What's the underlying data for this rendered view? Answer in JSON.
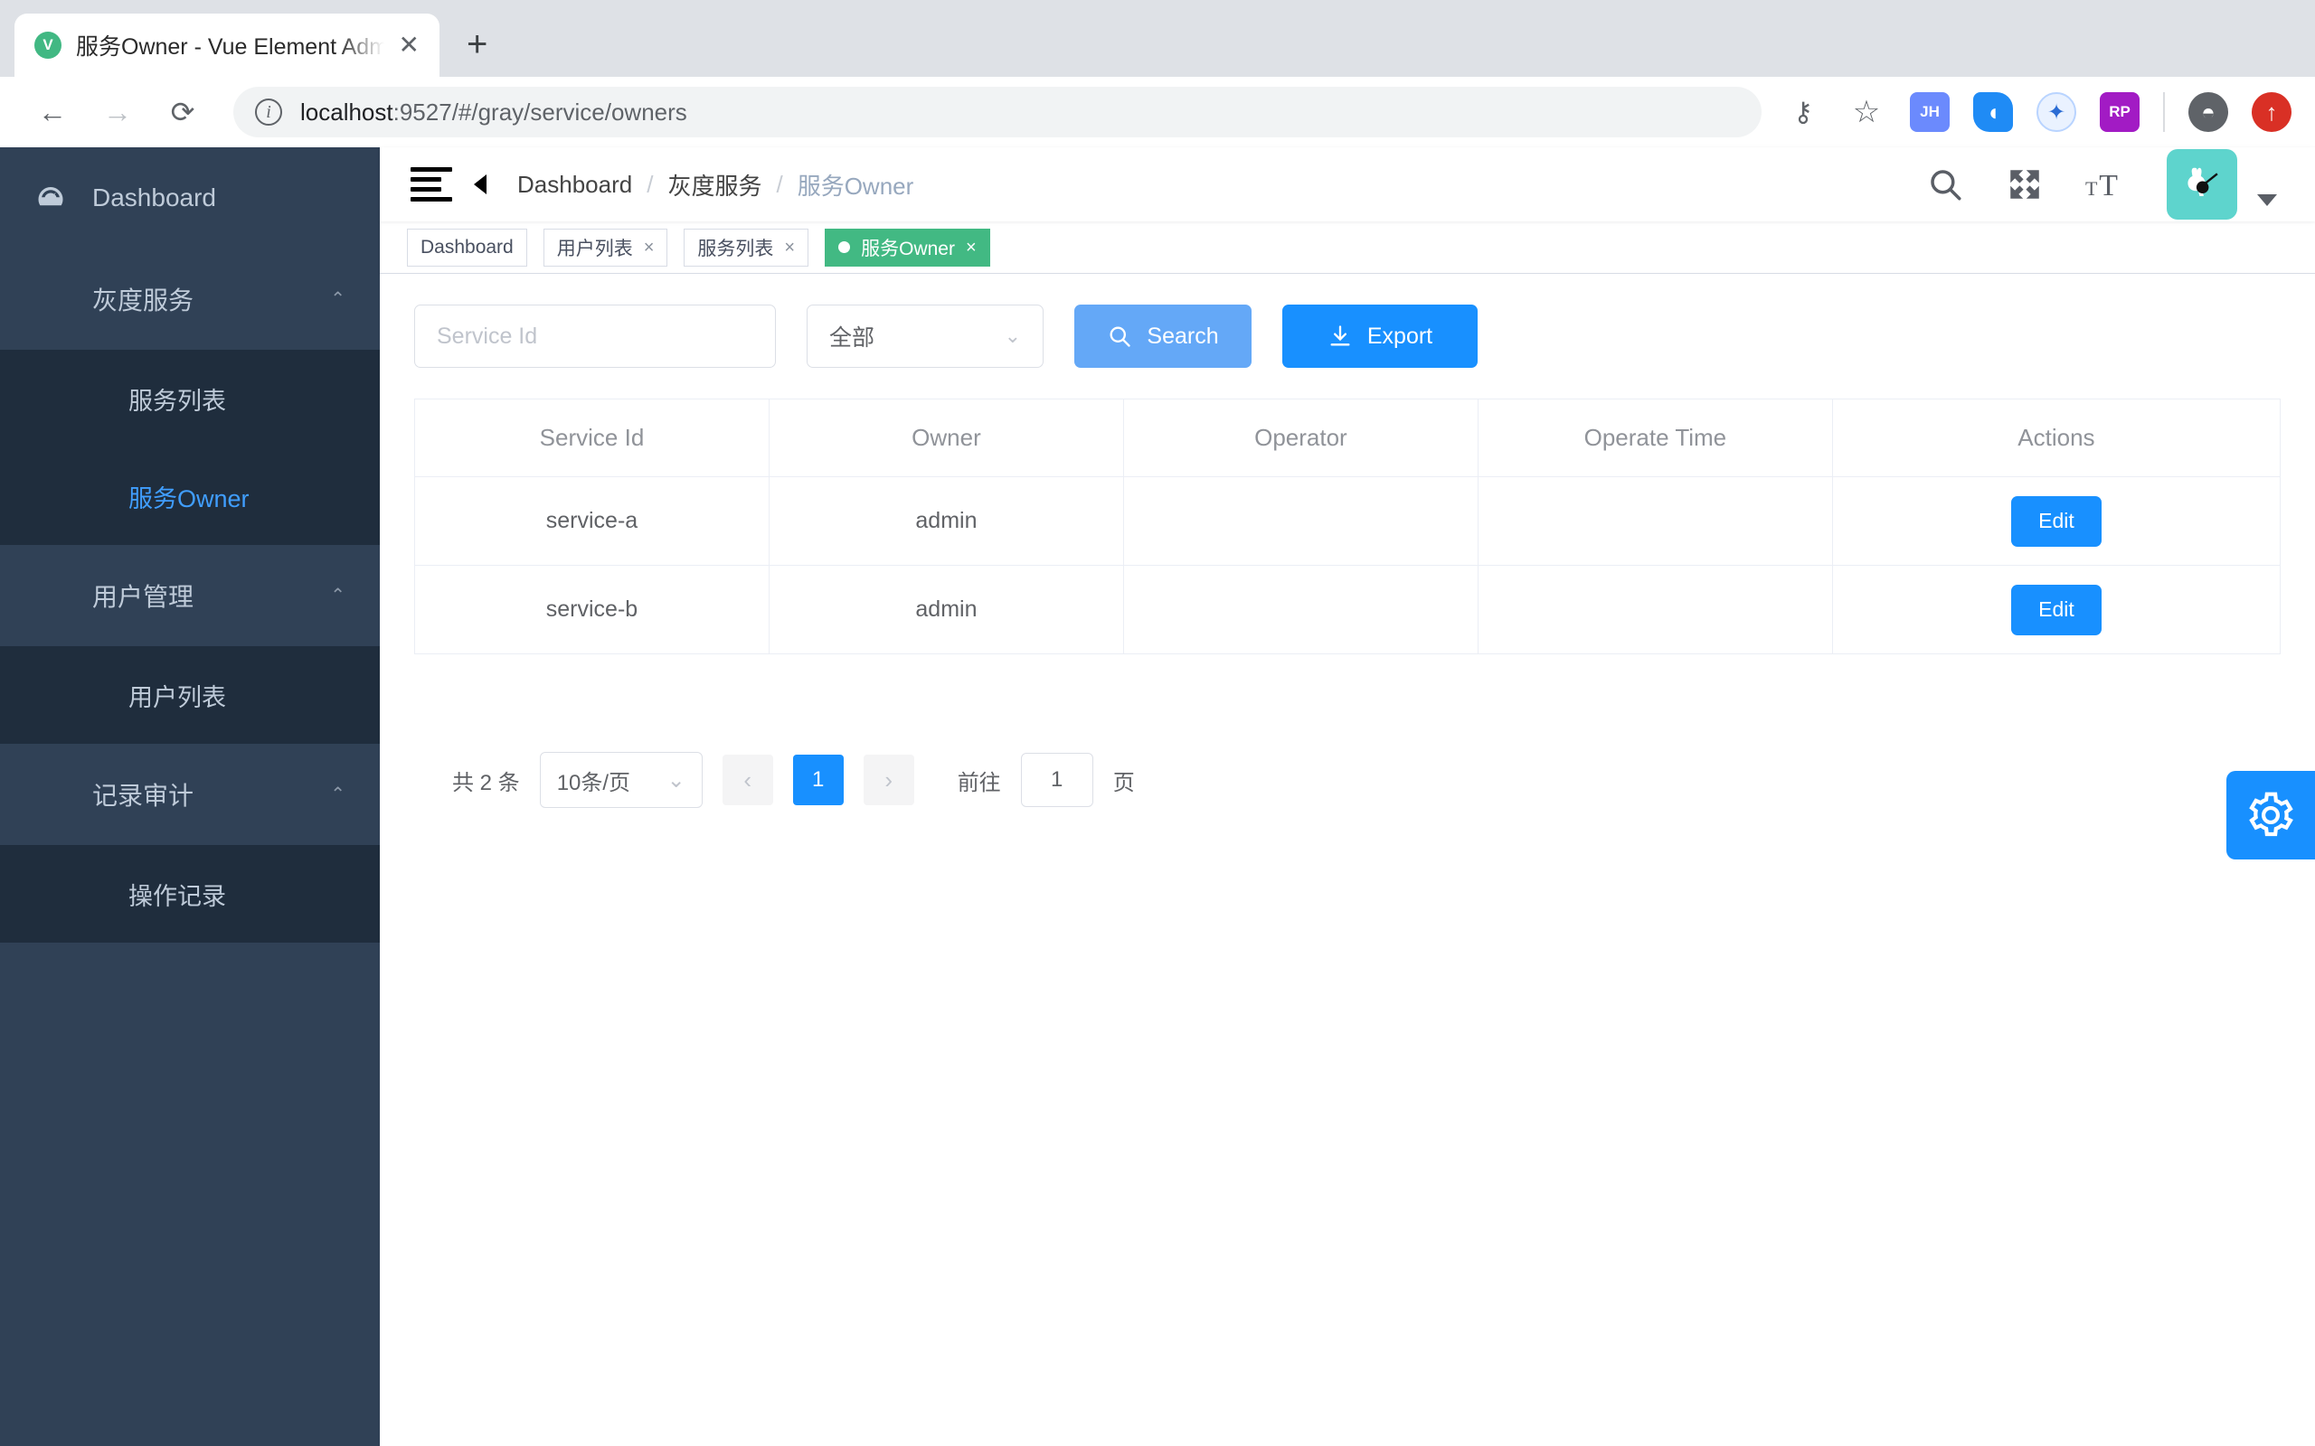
{
  "browser": {
    "tab_title": "服务Owner - Vue Element Admin",
    "favicon_letter": "V",
    "close_label": "✕",
    "new_tab_label": "+",
    "back_label": "←",
    "forward_label": "→",
    "reload_label": "⟳",
    "info_label": "i",
    "url_host": "localhost",
    "url_path": ":9527/#/gray/service/owners",
    "extensions": [
      {
        "name": "password-key-icon",
        "label": "⚷",
        "color": "transparent",
        "text_color": "#5f6368"
      },
      {
        "name": "bookmark-star-icon",
        "label": "☆",
        "color": "transparent",
        "text_color": "#5f6368"
      },
      {
        "name": "jh-extension-icon",
        "label": "JH",
        "color": "#6b8afd",
        "text_color": "#ffffff"
      },
      {
        "name": "droplet-extension-icon",
        "label": "◗",
        "color": "#1f8bf5",
        "text_color": "#ffffff"
      },
      {
        "name": "bird-extension-icon",
        "label": "✦",
        "color": "#f0f4ff",
        "text_color": "#2b6cd4"
      },
      {
        "name": "rp-extension-icon",
        "label": "RP",
        "color": "#a21bc4",
        "text_color": "#ffffff"
      },
      {
        "name": "profile-avatar-icon",
        "label": "●",
        "color": "transparent",
        "text_color": "#5f6368"
      },
      {
        "name": "browser-update-icon",
        "label": "↑",
        "color": "#d93025",
        "text_color": "#ffffff"
      }
    ]
  },
  "sidebar": {
    "items": [
      {
        "label": "Dashboard",
        "icon": "dashboard-gauge-icon",
        "active": false,
        "expandable": false
      },
      {
        "label": "灰度服务",
        "icon": "grid-icon",
        "active": false,
        "expandable": true
      },
      {
        "label": "服务列表",
        "icon": "grid-icon",
        "active": false,
        "sub": true
      },
      {
        "label": "服务Owner",
        "icon": "grid-icon",
        "active": true,
        "sub": true
      },
      {
        "label": "用户管理",
        "icon": "grid-icon",
        "active": false,
        "expandable": true
      },
      {
        "label": "用户列表",
        "icon": "grid-icon",
        "active": false,
        "sub": true
      },
      {
        "label": "记录审计",
        "icon": "grid-icon",
        "active": false,
        "expandable": true
      },
      {
        "label": "操作记录",
        "icon": "grid-icon",
        "active": false,
        "sub": true
      }
    ],
    "collapse_chevron": "⌃",
    "active_color": "#409eff",
    "bg_color": "#304156",
    "submenu_bg_color": "#1f2d3d"
  },
  "navbar": {
    "breadcrumb": [
      {
        "label": "Dashboard",
        "current": false
      },
      {
        "label": "灰度服务",
        "current": false
      },
      {
        "label": "服务Owner",
        "current": true
      }
    ],
    "separator": "/",
    "icons": [
      {
        "name": "search-icon"
      },
      {
        "name": "fullscreen-icon"
      },
      {
        "name": "font-size-icon"
      }
    ],
    "avatar_name": "user-avatar",
    "avatar_bg": "#5ed4cd"
  },
  "tags_view": {
    "tags": [
      {
        "label": "Dashboard",
        "active": false,
        "closable": false
      },
      {
        "label": "用户列表",
        "active": false,
        "closable": true
      },
      {
        "label": "服务列表",
        "active": false,
        "closable": true
      },
      {
        "label": "服务Owner",
        "active": true,
        "closable": true
      }
    ],
    "close_glyph": "×",
    "active_color": "#42b983"
  },
  "filter_bar": {
    "service_id_placeholder": "Service Id",
    "service_id_value": "",
    "status_select_value": "全部",
    "select_chevron": "⌄",
    "search_label": "Search",
    "search_icon": "search-icon",
    "export_label": "Export",
    "export_icon": "download-icon",
    "search_color": "#64a8f7",
    "export_color": "#1890ff"
  },
  "table": {
    "columns": [
      "Service Id",
      "Owner",
      "Operator",
      "Operate Time",
      "Actions"
    ],
    "rows": [
      {
        "service_id": "service-a",
        "owner": "admin",
        "operator": "",
        "operate_time": "",
        "action": "Edit"
      },
      {
        "service_id": "service-b",
        "owner": "admin",
        "operator": "",
        "operate_time": "",
        "action": "Edit"
      }
    ]
  },
  "pagination": {
    "total_label": "共 2 条",
    "page_size_label": "10条/页",
    "page_size_chevron": "⌄",
    "prev_glyph": "‹",
    "next_glyph": "›",
    "current_page": "1",
    "jumper_prefix": "前往",
    "jumper_value": "1",
    "jumper_suffix": "页"
  },
  "right_panel": {
    "icon": "gear-icon",
    "color": "#1890ff"
  }
}
